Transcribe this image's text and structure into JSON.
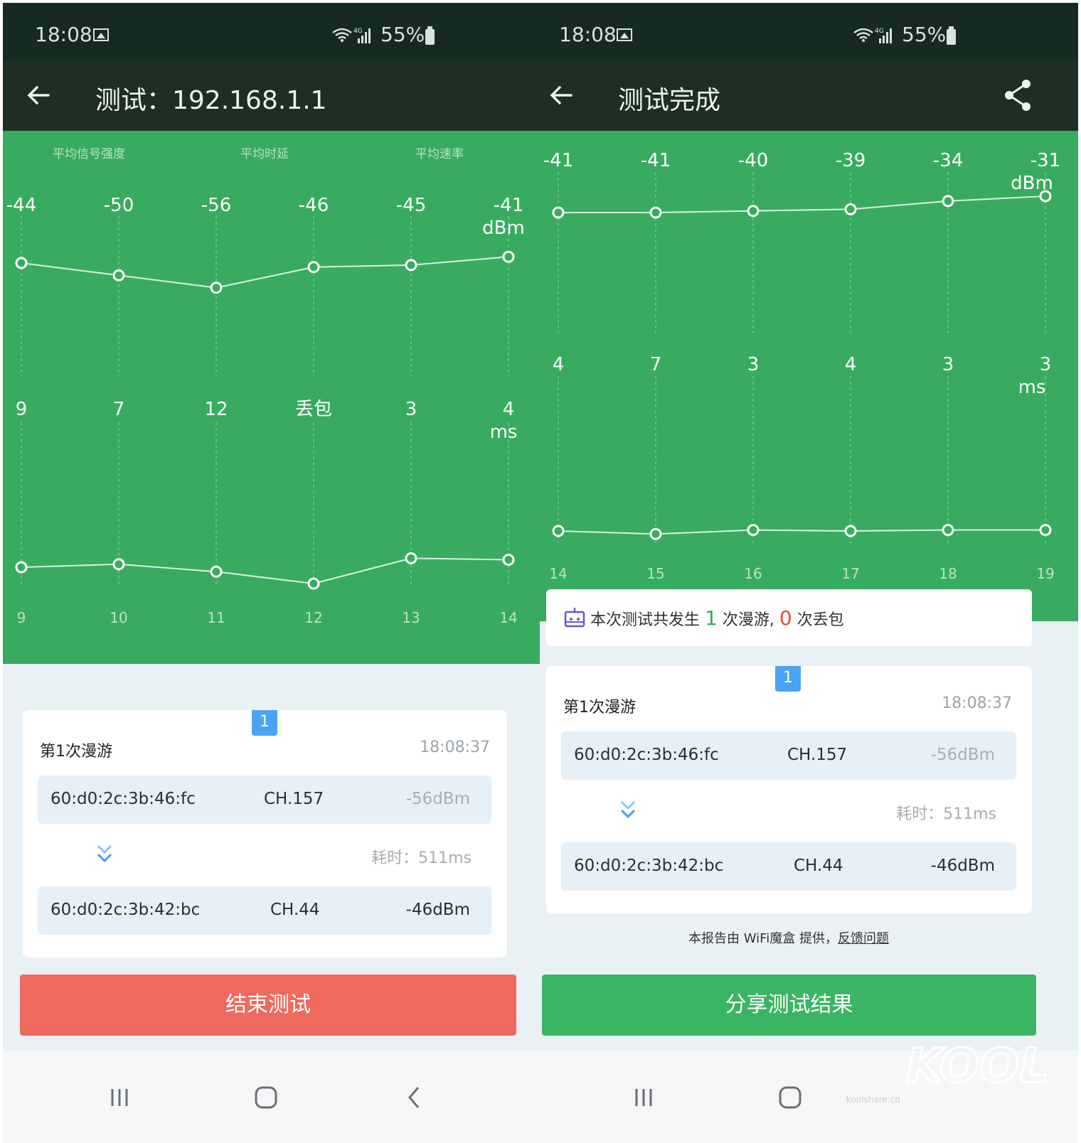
{
  "left": {
    "status": {
      "time": "18:08",
      "battery": "55%",
      "network": "4G"
    },
    "title": "测试：192.168.1.1",
    "summary_labels": [
      "平均信号强度",
      "平均时延",
      "平均速率"
    ],
    "signal": {
      "values": [
        -44,
        -50,
        -56,
        -46,
        -45,
        -41
      ],
      "labels": [
        "-44",
        "-50",
        "-56",
        "-46",
        "-45",
        "-41"
      ],
      "unit": "dBm"
    },
    "latency": {
      "values": [
        9,
        7,
        12,
        null,
        3,
        4
      ],
      "labels": [
        "9",
        "7",
        "12",
        "丢包",
        "3",
        "4"
      ],
      "unit": "ms"
    },
    "x_labels": [
      "9",
      "10",
      "11",
      "12",
      "13",
      "14"
    ],
    "roam": {
      "badge": "1",
      "title": "第1次漫游",
      "time": "18:08:37",
      "from": {
        "mac": "60:d0:2c:3b:46:fc",
        "channel": "CH.157",
        "rssi": "-56dBm"
      },
      "duration": "耗时：511ms",
      "to": {
        "mac": "60:d0:2c:3b:42:bc",
        "channel": "CH.44",
        "rssi": "-46dBm"
      }
    },
    "button": "结束测试"
  },
  "right": {
    "status": {
      "time": "18:08",
      "battery": "55%",
      "network": "4G"
    },
    "title": "测试完成",
    "signal": {
      "values": [
        -41,
        -41,
        -40,
        -39,
        -34,
        -31
      ],
      "labels": [
        "-41",
        "-41",
        "-40",
        "-39",
        "-34",
        "-31"
      ],
      "unit": "dBm"
    },
    "latency": {
      "values": [
        4,
        7,
        3,
        4,
        3,
        3
      ],
      "labels": [
        "4",
        "7",
        "3",
        "4",
        "3",
        "3"
      ],
      "unit": "ms"
    },
    "x_labels": [
      "14",
      "15",
      "16",
      "17",
      "18",
      "19"
    ],
    "summary": {
      "prefix": "本次测试共发生",
      "roam_count": "1",
      "middle": "次漫游,",
      "loss_count": "0",
      "suffix": "次丢包"
    },
    "roam": {
      "badge": "1",
      "title": "第1次漫游",
      "time": "18:08:37",
      "from": {
        "mac": "60:d0:2c:3b:46:fc",
        "channel": "CH.157",
        "rssi": "-56dBm"
      },
      "duration": "耗时：511ms",
      "to": {
        "mac": "60:d0:2c:3b:42:bc",
        "channel": "CH.44",
        "rssi": "-46dBm"
      }
    },
    "footer": {
      "text": "本报告由 WiFi魔盒 提供，",
      "link": "反馈问题"
    },
    "button": "分享测试结果"
  },
  "watermark": {
    "logo": "KOOL SHARE",
    "site": "koolshare.cn"
  },
  "colors": {
    "chart_bg": "#38ab60",
    "header_bg": "#1d2f25",
    "status_bg": "#172a21",
    "end_button": "#ef6a5e",
    "share_button": "#3ab564",
    "badge": "#4aa3f5"
  }
}
